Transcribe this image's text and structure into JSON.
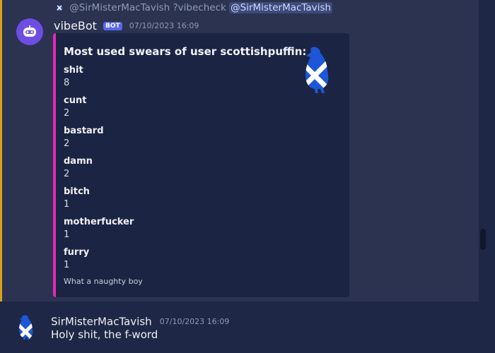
{
  "reply": {
    "author": "@SirMisterMacTavish",
    "command": "?vibecheck",
    "mention": "@SirMisterMacTavish"
  },
  "bot_message": {
    "author": "vibeBot",
    "tag": "BOT",
    "timestamp": "07/10/2023 16:09",
    "accent_color": "#d8a31a",
    "embed": {
      "accent_color": "#e528b8",
      "title": "Most used swears of user scottishpuffin:",
      "fields": [
        {
          "name": "shit",
          "value": "8"
        },
        {
          "name": "cunt",
          "value": "2"
        },
        {
          "name": "bastard",
          "value": "2"
        },
        {
          "name": "damn",
          "value": "2"
        },
        {
          "name": "bitch",
          "value": "1"
        },
        {
          "name": "motherfucker",
          "value": "1"
        },
        {
          "name": "furry",
          "value": "1"
        }
      ],
      "footer": "What a naughty boy",
      "thumbnail_icon": "scottish-flag-puffin-icon"
    }
  },
  "user_message": {
    "author": "SirMisterMacTavish",
    "timestamp": "07/10/2023 16:09",
    "text": "Holy shit, the f-word",
    "avatar_icon": "scottish-flag-puffin-icon"
  },
  "icons": {
    "bot_avatar": "discord-robot-icon",
    "reply": "reply-avatar-icon"
  }
}
